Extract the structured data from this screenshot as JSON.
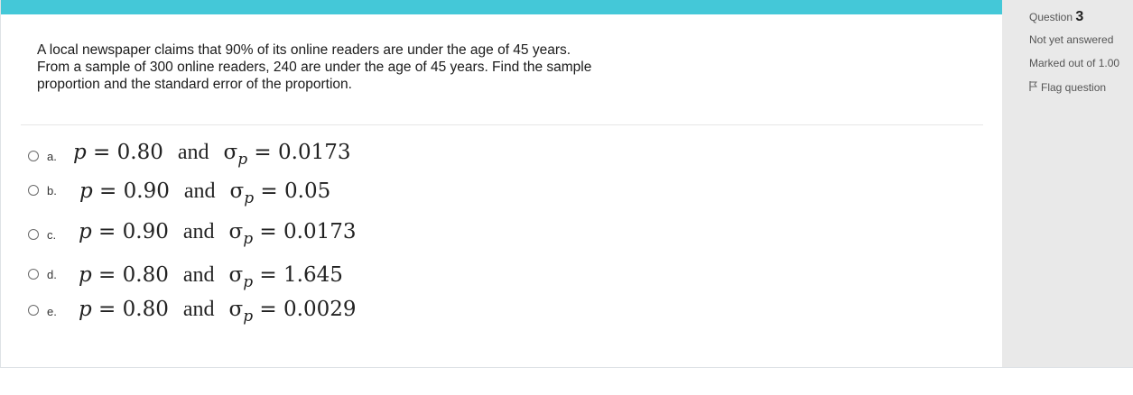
{
  "question": {
    "text": "A local newspaper claims that 90% of its online readers are under the age of 45 years.\nFrom a sample of 300 online readers, 240 are under the age of 45 years.  Find the sample\nproportion and the standard error of the proportion."
  },
  "options": [
    {
      "letter": "a.",
      "p": "0.80",
      "and": "and",
      "sigma": "0.0173"
    },
    {
      "letter": "b.",
      "p": "0.90",
      "and": "and",
      "sigma": "0.05"
    },
    {
      "letter": "c.",
      "p": "0.90",
      "and": "and",
      "sigma": "0.0173"
    },
    {
      "letter": "d.",
      "p": "0.80",
      "and": "and",
      "sigma": "1.645"
    },
    {
      "letter": "e.",
      "p": "0.80",
      "and": "and",
      "sigma": "0.0029"
    }
  ],
  "sidebar": {
    "question_label": "Question",
    "question_number": "3",
    "state": "Not yet answered",
    "marked": "Marked out of 1.00",
    "flag_label": "Flag question",
    "flag_icon": "flag-icon"
  },
  "colors": {
    "accent_bar": "#44c8d8",
    "sidebar_bg": "#e9e9e9"
  }
}
